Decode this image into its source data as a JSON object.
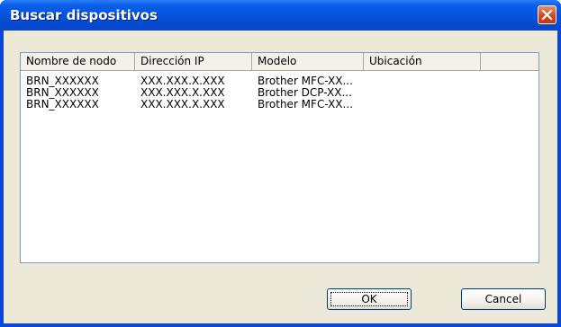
{
  "window": {
    "title": "Buscar dispositivos",
    "close_icon": "close-x-icon"
  },
  "list": {
    "columns": [
      "Nombre de nodo",
      "Dirección IP",
      "Modelo",
      "Ubicación"
    ],
    "rows": [
      {
        "node": "BRN_XXXXXX",
        "ip": "XXX.XXX.X.XXX",
        "model": "Brother MFC-XX...",
        "location": ""
      },
      {
        "node": "BRN_XXXXXX",
        "ip": "XXX.XXX.X.XXX",
        "model": "Brother DCP-XX...",
        "location": ""
      },
      {
        "node": "BRN_XXXXXX",
        "ip": "XXX.XXX.X.XXX",
        "model": "Brother MFC-XX...",
        "location": ""
      }
    ]
  },
  "buttons": {
    "ok": "OK",
    "cancel": "Cancel"
  },
  "colors": {
    "titlebar": "#0653dc",
    "client": "#ece9d8",
    "close": "#d8451f"
  }
}
